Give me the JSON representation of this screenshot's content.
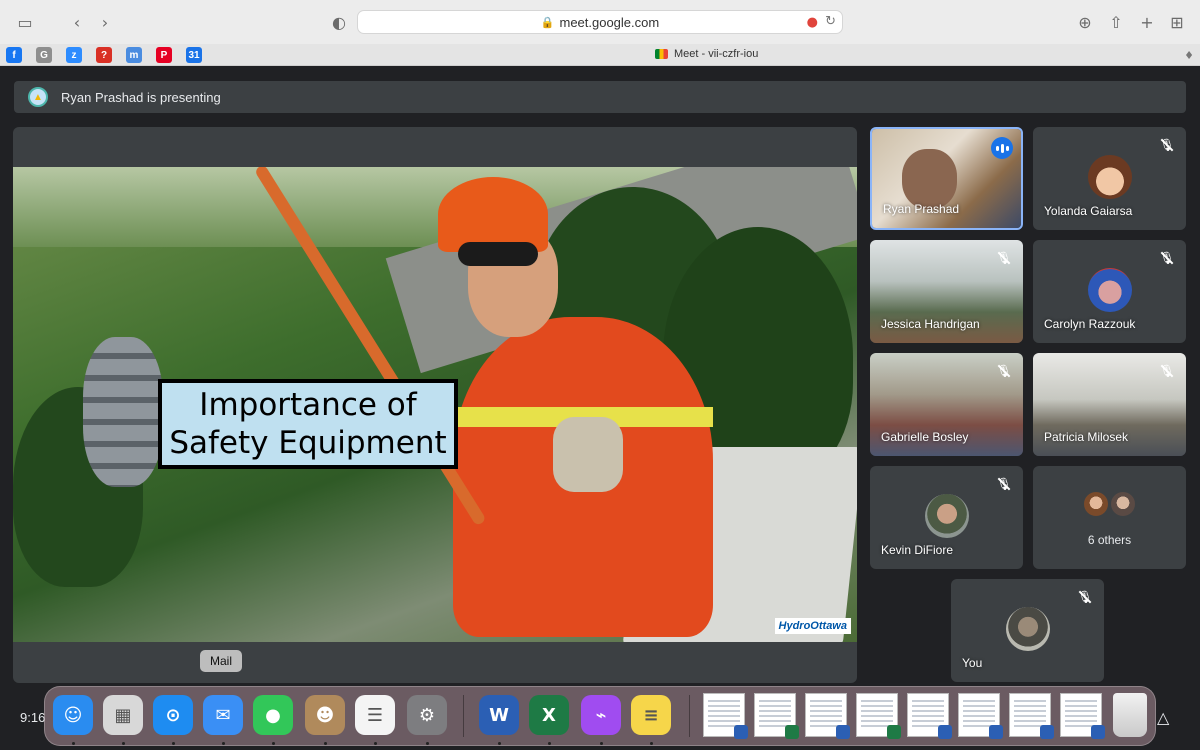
{
  "browser": {
    "url": "meet.google.com",
    "tab_title": "Meet - vii-czfr-iou",
    "favorites": [
      {
        "icon": "facebook-icon",
        "letter": "f",
        "color": "#1877f2"
      },
      {
        "icon": "google-icon",
        "letter": "G",
        "color": "#8e8e8e"
      },
      {
        "icon": "zoom-icon",
        "letter": "z",
        "color": "#2d8cff"
      },
      {
        "icon": "bookmark-red-icon",
        "letter": "?",
        "color": "#d93025"
      },
      {
        "icon": "gmail-icon",
        "letter": "m",
        "color": "#4a8ce0"
      },
      {
        "icon": "pinterest-icon",
        "letter": "P",
        "color": "#e60023"
      },
      {
        "icon": "calendar-icon",
        "letter": "31",
        "color": "#1a73e8"
      }
    ]
  },
  "meet": {
    "presenting_text": "Ryan Prashad is presenting",
    "slide": {
      "title_line1": "Importance of",
      "title_line2": "Safety Equipment",
      "logo_text": "HydroOttawa"
    },
    "participants": [
      {
        "name": "Ryan Prashad",
        "muted": false,
        "speaking": true
      },
      {
        "name": "Yolanda Gaiarsa",
        "muted": true
      },
      {
        "name": "Jessica Handrigan",
        "muted": true
      },
      {
        "name": "Carolyn Razzouk",
        "muted": true
      },
      {
        "name": "Gabrielle Bosley",
        "muted": true
      },
      {
        "name": "Patricia Milosek",
        "muted": true
      },
      {
        "name": "Kevin DiFiore",
        "muted": true
      },
      {
        "name": "6 others"
      },
      {
        "name": "You",
        "muted": true
      }
    ]
  },
  "system": {
    "clock": "9:16",
    "dock_tooltip": "Mail",
    "dock_apps": [
      {
        "name": "finder-icon",
        "color": "#2a8cf0",
        "glyph": "☺"
      },
      {
        "name": "launchpad-icon",
        "color": "#d8d8d8",
        "glyph": "▦"
      },
      {
        "name": "safari-icon",
        "color": "#1e8cf1",
        "glyph": "⊙"
      },
      {
        "name": "mail-icon",
        "color": "#3a8ff5",
        "glyph": "✉"
      },
      {
        "name": "messages-icon",
        "color": "#32c759",
        "glyph": "●"
      },
      {
        "name": "contacts-icon",
        "color": "#b08a5c",
        "glyph": "☻"
      },
      {
        "name": "reminders-icon",
        "color": "#f4f4f4",
        "glyph": "☰"
      },
      {
        "name": "system-preferences-icon",
        "color": "#7d7d80",
        "glyph": "⚙"
      },
      {
        "name": "word-icon",
        "color": "#2b5fb4",
        "glyph": "W"
      },
      {
        "name": "excel-icon",
        "color": "#1e7a45",
        "glyph": "X"
      },
      {
        "name": "messenger-icon",
        "color": "#a04cf0",
        "glyph": "⌁"
      },
      {
        "name": "notes-icon",
        "color": "#f6d64a",
        "glyph": "≡"
      }
    ]
  }
}
